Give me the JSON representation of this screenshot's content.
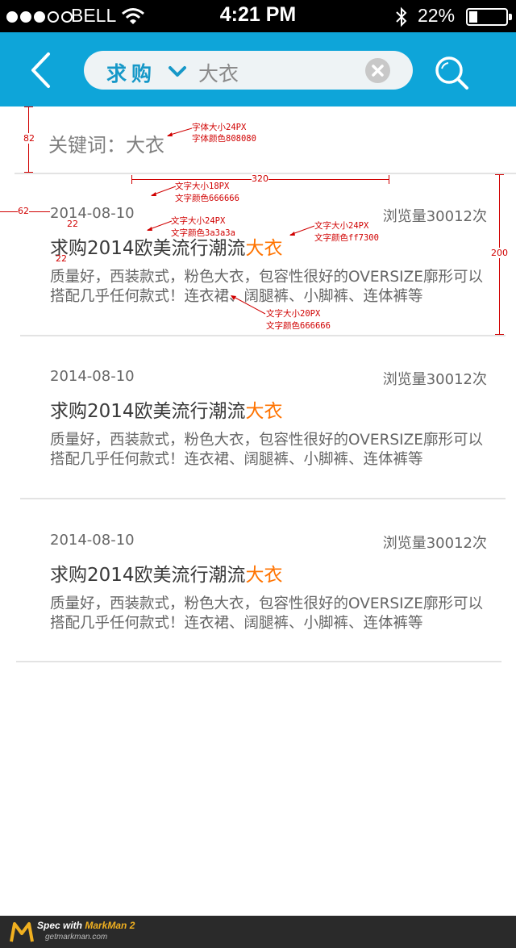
{
  "status_bar": {
    "carrier": "BELL",
    "time": "4:21 PM",
    "battery": "22%"
  },
  "nav": {
    "search_type": "求购",
    "search_text": "大衣"
  },
  "keyword_line": "关键词：大衣",
  "items": [
    {
      "date": "2014-08-10",
      "views": "浏览量30012次",
      "title": "求购2014欧美流行潮流",
      "title_highlight": "大衣",
      "desc": "质量好，西装款式，粉色大衣，包容性很好的OVERSIZE廓形可以搭配几乎任何款式！连衣裙、阔腿裤、小脚裤、连体裤等"
    },
    {
      "date": "2014-08-10",
      "views": "浏览量30012次",
      "title": "求购2014欧美流行潮流",
      "title_highlight": "大衣",
      "desc": "质量好，西装款式，粉色大衣，包容性很好的OVERSIZE廓形可以搭配几乎任何款式！连衣裙、阔腿裤、小脚裤、连体裤等"
    },
    {
      "date": "2014-08-10",
      "views": "浏览量30012次",
      "title": "求购2014欧美流行潮流",
      "title_highlight": "大衣",
      "desc": "质量好，西装款式，粉色大衣，包容性很好的OVERSIZE廓形可以搭配几乎任何款式！连衣裙、阔腿裤、小脚裤、连体裤等"
    }
  ],
  "annotations": {
    "keyword_font": "字体大小24PX",
    "keyword_color": "字体颜色808080",
    "date_size": "文字大小18PX",
    "date_color": "文字颜色666666",
    "title_size": "文字大小24PX",
    "title_color": "文字颜色3a3a3a",
    "hl_size": "文字大小24PX",
    "hl_color": "文字颜色ff7300",
    "desc_size": "文字大小20PX",
    "desc_color": "文字颜色666666",
    "dim_82": "82",
    "dim_320": "320",
    "dim_62": "62",
    "dim_22a": "22",
    "dim_22b": "22",
    "dim_200": "200"
  },
  "footer": {
    "spec_with": "Spec with ",
    "markman": "MarkMan 2",
    "url": "getmarkman.com"
  },
  "colors": {
    "nav_bg": "#0ea5d9",
    "keyword": "#808080",
    "title": "#3a3a3a",
    "highlight": "#ff7300",
    "secondary": "#666666",
    "annotation": "#d00000"
  }
}
